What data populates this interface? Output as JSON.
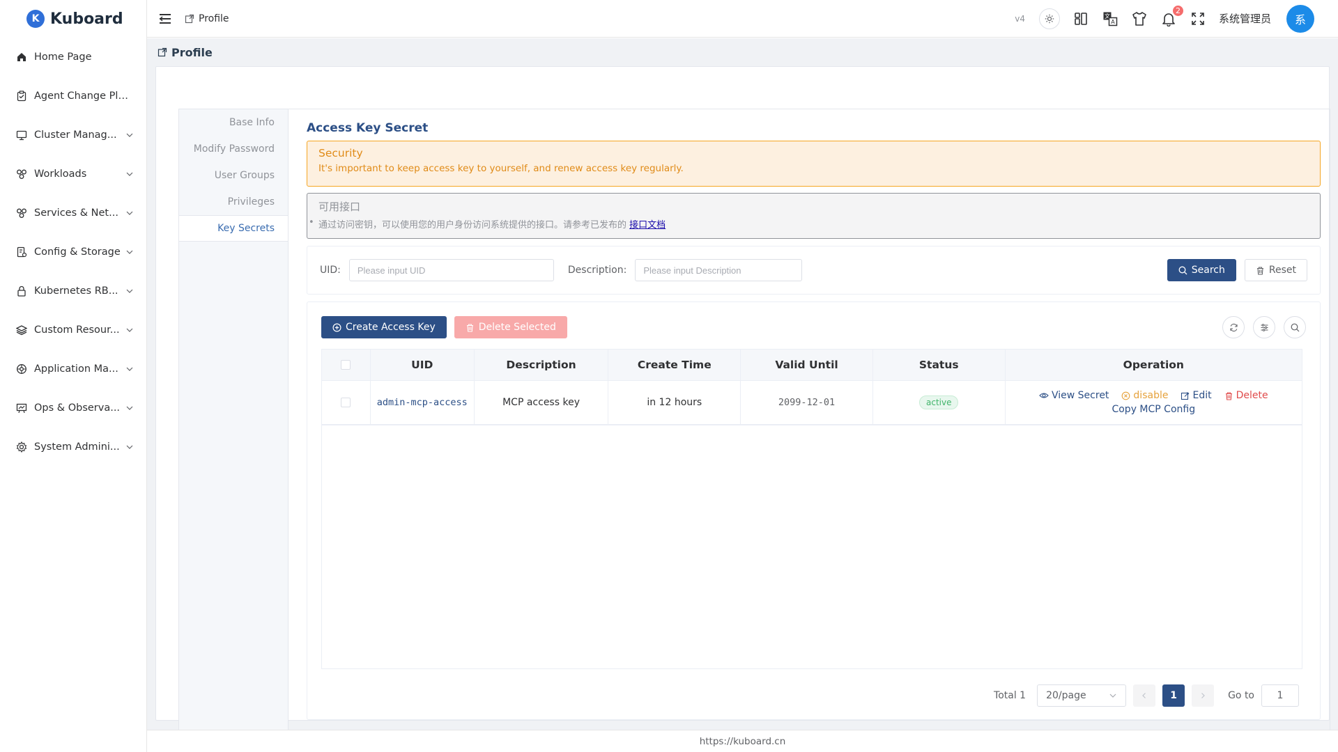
{
  "app": {
    "logo_letter": "K",
    "name": "Kuboard"
  },
  "sidebar": {
    "items": [
      {
        "label": "Home Page",
        "icon": "home-icon",
        "has_children": false
      },
      {
        "label": "Agent Change Plans",
        "icon": "clipboard-check-icon",
        "has_children": false
      },
      {
        "label": "Cluster Manag...",
        "icon": "monitor-icon",
        "has_children": true
      },
      {
        "label": "Workloads",
        "icon": "workloads-icon",
        "has_children": true
      },
      {
        "label": "Services & Net...",
        "icon": "network-icon",
        "has_children": true
      },
      {
        "label": "Config & Storage",
        "icon": "config-storage-icon",
        "has_children": true
      },
      {
        "label": "Kubernetes RB...",
        "icon": "lock-icon",
        "has_children": true
      },
      {
        "label": "Custom Resour...",
        "icon": "layers-icon",
        "has_children": true
      },
      {
        "label": "Application Ma...",
        "icon": "app-gear-icon",
        "has_children": true
      },
      {
        "label": "Ops & Observa...",
        "icon": "dashboard-icon",
        "has_children": true
      },
      {
        "label": "System Admini...",
        "icon": "gear-icon",
        "has_children": true
      }
    ]
  },
  "header": {
    "breadcrumb": "Profile",
    "version": "v4",
    "notification_count": "2",
    "username": "系统管理员",
    "avatar_text": "系"
  },
  "page": {
    "title": "Profile",
    "tabs": [
      {
        "label": "Base Info",
        "active": false
      },
      {
        "label": "Modify Password",
        "active": false
      },
      {
        "label": "User Groups",
        "active": false
      },
      {
        "label": "Privileges",
        "active": false
      },
      {
        "label": "Key Secrets",
        "active": true
      }
    ],
    "section_title": "Access Key Secret",
    "security_alert": {
      "title": "Security",
      "description": "It's important to keep access key to yourself, and renew access key regularly."
    },
    "api_alert": {
      "title": "可用接口",
      "description": "通过访问密钥，可以使用您的用户身份访问系统提供的接口。请参考已发布的",
      "link": "接口文档"
    }
  },
  "search": {
    "uid_label": "UID:",
    "uid_placeholder": "Please input UID",
    "desc_label": "Description:",
    "desc_placeholder": "Please input Description",
    "search_button": "Search",
    "reset_button": "Reset"
  },
  "toolbar": {
    "create_button": "Create Access Key",
    "delete_selected_button": "Delete Selected"
  },
  "table": {
    "columns": [
      "UID",
      "Description",
      "Create Time",
      "Valid Until",
      "Status",
      "Operation"
    ],
    "rows": [
      {
        "uid": "admin-mcp-access",
        "description": "MCP access key",
        "create_time": "in 12 hours",
        "valid_until": "2099-12-01",
        "status": "active",
        "operations": {
          "view": "View Secret",
          "disable": "disable",
          "edit": "Edit",
          "delete": "Delete",
          "copy": "Copy MCP Config"
        }
      }
    ]
  },
  "pagination": {
    "total": "Total 1",
    "page_size": "20/page",
    "current_page": "1",
    "goto_label": "Go to",
    "goto_value": "1"
  },
  "footer": {
    "url": "https://kuboard.cn"
  },
  "colors": {
    "primary": "#2c4f86",
    "warning": "#e08b18",
    "danger": "#e04b4b",
    "success": "#40b46a",
    "avatar": "#1c8be8"
  }
}
